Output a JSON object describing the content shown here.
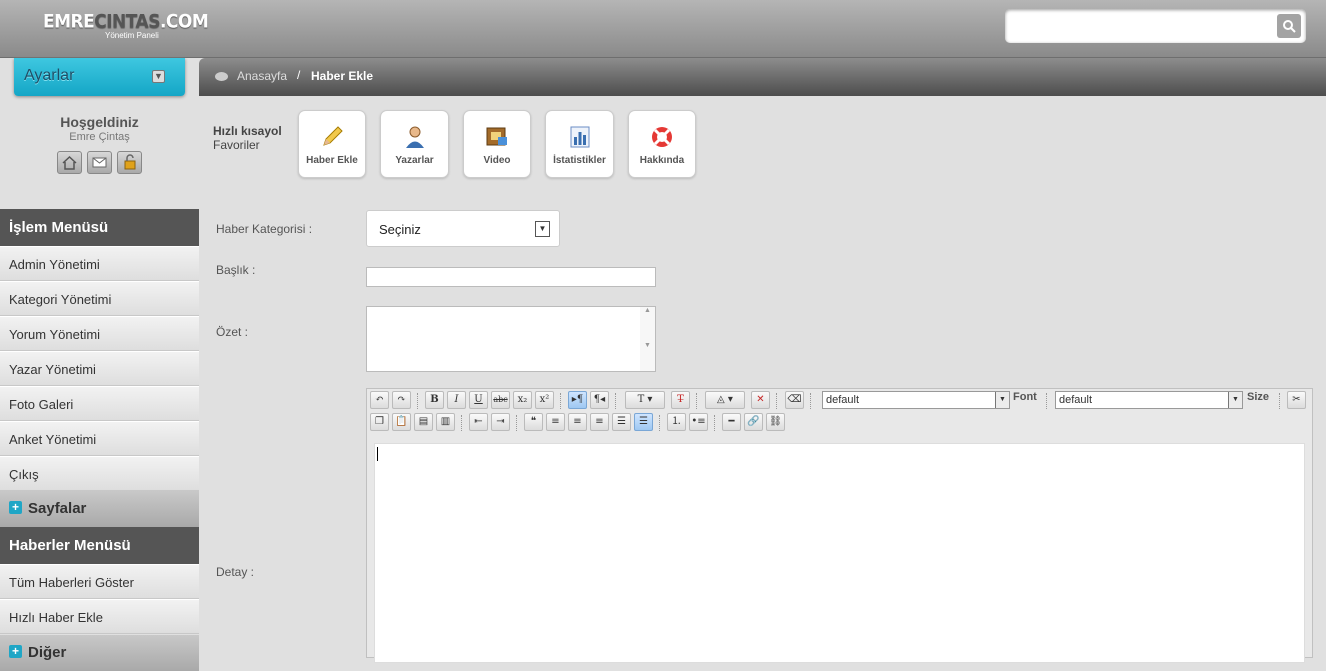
{
  "logo": {
    "brand_light": "EMRE",
    "brand_mid": "CINTAS",
    "brand_tail": ".COM",
    "sub": "Yönetim Paneli"
  },
  "search": {
    "placeholder": "",
    "icon": "search-icon"
  },
  "sidebar": {
    "settings_label": "Ayarlar",
    "welcome_title": "Hoşgeldiniz",
    "welcome_user": "Emre Çintaş",
    "quick_icons": [
      "home-icon",
      "mail-icon",
      "lock-icon"
    ],
    "islem_head": "İşlem Menüsü",
    "islem_items": [
      "Admin Yönetimi",
      "Kategori Yönetimi",
      "Yorum Yönetimi",
      "Yazar Yönetimi",
      "Foto Galeri",
      "Anket Yönetimi",
      "Çıkış"
    ],
    "sayfalar_label": "Sayfalar",
    "haberler_head": "Haberler Menüsü",
    "haberler_items": [
      "Tüm Haberleri Göster",
      "Hızlı Haber Ekle"
    ],
    "diger_label": "Diğer"
  },
  "breadcrumb": {
    "home": "Anasayfa",
    "sep": "/",
    "current": "Haber Ekle"
  },
  "quick": {
    "label_1": "Hızlı kısayol",
    "label_2": "Favoriler",
    "buttons": [
      {
        "label": "Haber Ekle",
        "icon": "pencil-icon"
      },
      {
        "label": "Yazarlar",
        "icon": "user-icon"
      },
      {
        "label": "Video",
        "icon": "video-icon"
      },
      {
        "label": "İstatistikler",
        "icon": "chart-icon"
      },
      {
        "label": "Hakkında",
        "icon": "lifebuoy-icon"
      }
    ]
  },
  "form": {
    "kategori_label": "Haber Kategorisi :",
    "kategori_value": "Seçiniz",
    "baslik_label": "Başlık :",
    "baslik_value": "",
    "ozet_label": "Özet :",
    "ozet_value": "",
    "detay_label": "Detay :"
  },
  "editor": {
    "font_value": "default",
    "font_label": "Font",
    "size_value": "default",
    "size_label": "Size"
  }
}
